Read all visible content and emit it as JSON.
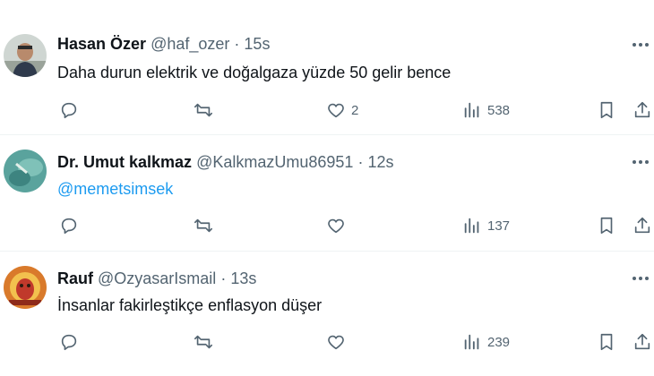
{
  "colors": {
    "text": "#0f1419",
    "secondary": "#536471",
    "accent": "#1d9bf0",
    "divider": "#eff3f4"
  },
  "tweets": [
    {
      "name": "Hasan Özer",
      "handle": "@haf_ozer",
      "dot": "·",
      "time": "15s",
      "text": "Daha durun elektrik ve doğalgaza yüzde 50 gelir bence",
      "likes": "2",
      "views": "538"
    },
    {
      "name": "Dr. Umut kalkmaz",
      "handle": "@KalkmazUmu86951",
      "dot": "·",
      "time": "12s",
      "text": "@memetsimsek",
      "likes": "",
      "views": "137"
    },
    {
      "name": "Rauf",
      "handle": "@OzyasarIsmail",
      "dot": "·",
      "time": "13s",
      "text": "İnsanlar fakirleştikçe enflasyon düşer",
      "likes": "",
      "views": "239"
    }
  ],
  "icons": {
    "more": "more-icon",
    "reply": "reply-icon",
    "retweet": "retweet-icon",
    "like": "heart-icon",
    "views": "views-icon",
    "bookmark": "bookmark-icon",
    "share": "share-icon"
  }
}
